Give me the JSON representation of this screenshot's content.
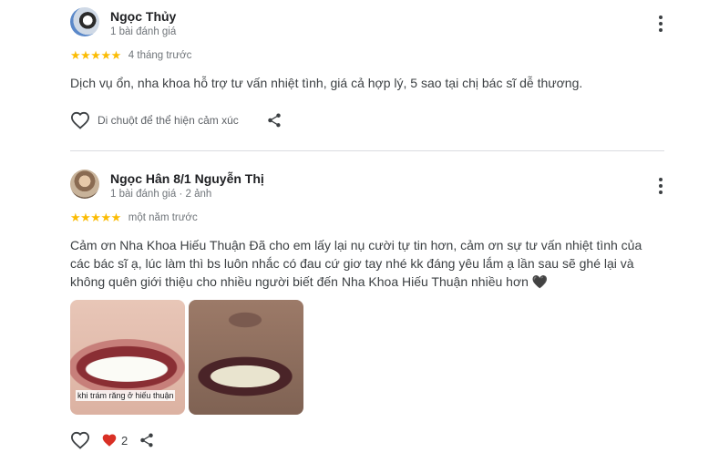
{
  "reviews": [
    {
      "name": "Ngọc Thủy",
      "meta": "1 bài đánh giá",
      "stars": "★★★★★",
      "time": "4 tháng trước",
      "text": "Dịch vụ ổn, nha khoa hỗ trợ tư vấn nhiệt tình, giá cả hợp lý, 5 sao tại chị bác sĩ dễ thương.",
      "hint": "Di chuột để thể hiện cảm xúc"
    },
    {
      "name": "Ngọc Hân 8/1 Nguyễn Thị",
      "meta": "1 bài đánh giá · 2 ảnh",
      "stars": "★★★★★",
      "time": "một năm trước",
      "text": "Cảm ơn Nha Khoa Hiếu Thuận Đã cho em lấy lại nụ cười tự tin hơn, cảm ơn sự tư vấn nhiệt tình của các bác sĩ ạ, lúc làm thì bs luôn nhắc có đau cứ giơ tay nhé kk đáng yêu lắm ạ lần sau sẽ ghé lại và không quên giới thiệu cho nhiều người biết đến Nha Khoa Hiếu Thuận nhiều hơn 🖤",
      "photo_caption": "khi trám răng ở hiếu thuận",
      "reaction_count": "2"
    }
  ],
  "colors": {
    "star": "#fbbc04",
    "heart": "#d93025"
  },
  "icons": [
    "avatar",
    "more-vert-icon",
    "star-icon",
    "heart-outline-icon",
    "heart-filled-icon",
    "share-icon"
  ]
}
